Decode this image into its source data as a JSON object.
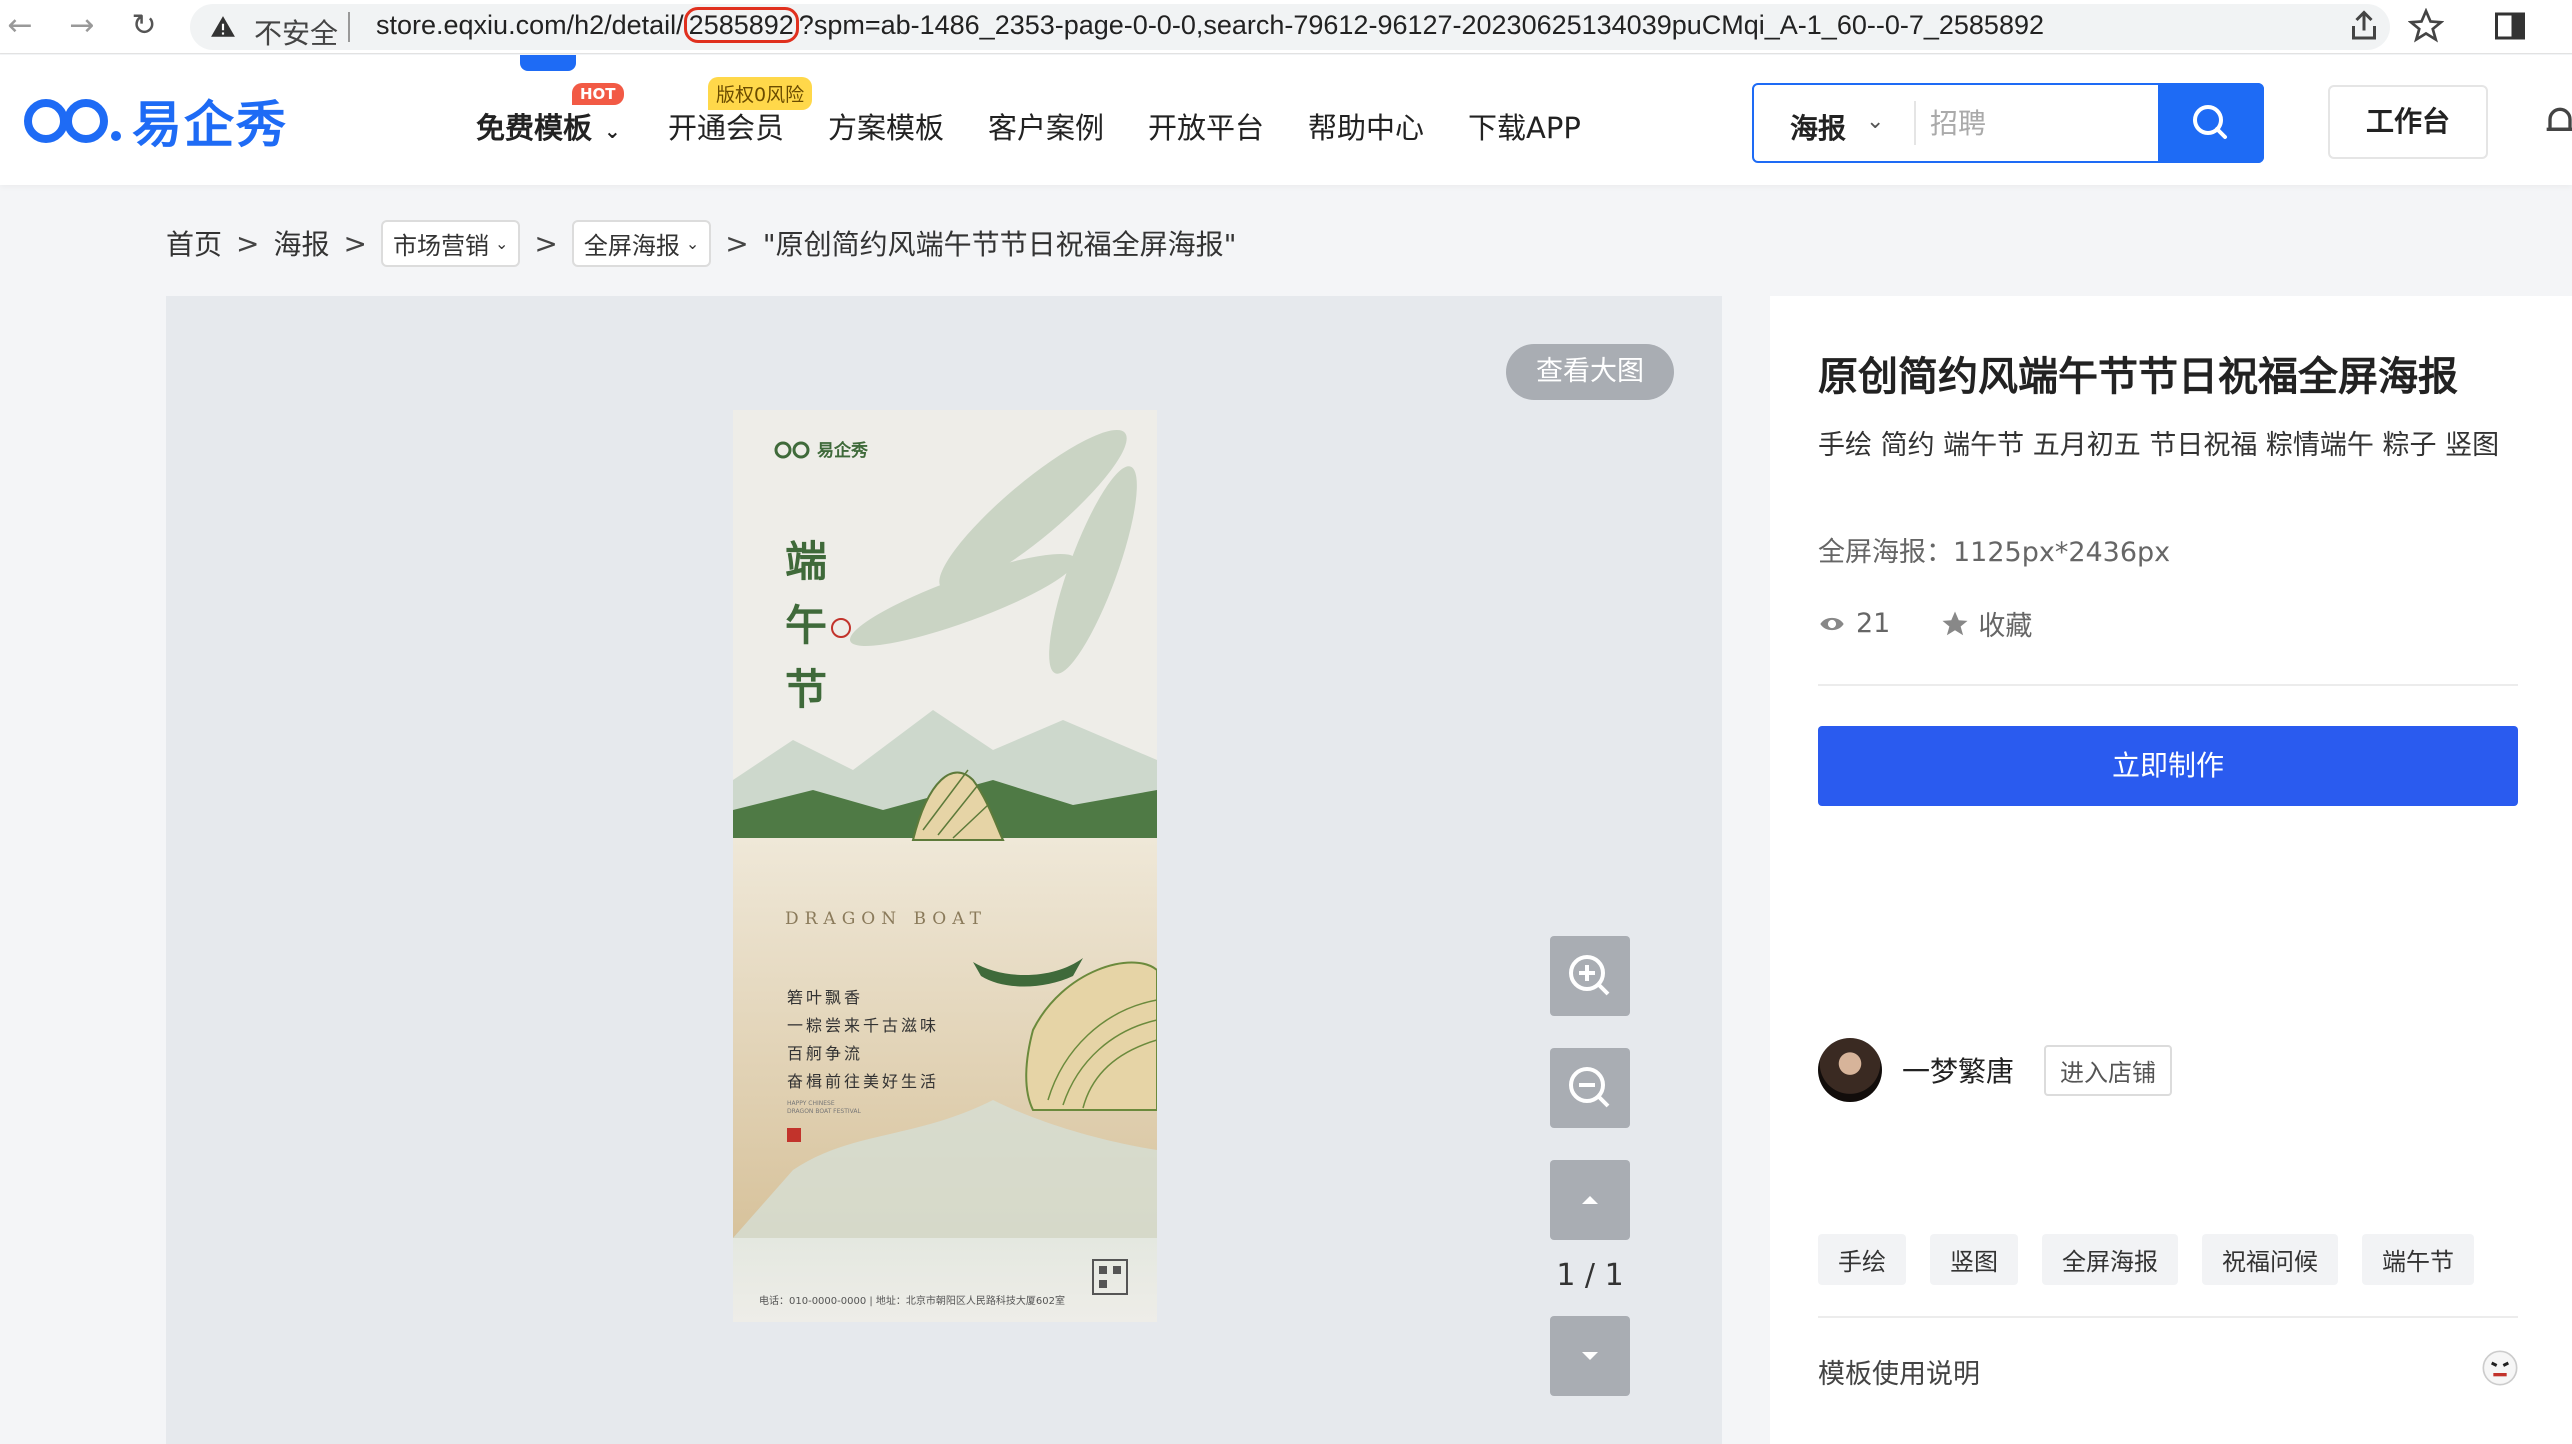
{
  "browser": {
    "insecure_label": "不安全",
    "url_prefix": "store.eqxiu.com/h2/detail/",
    "url_id": "2585892",
    "url_suffix": "?spm=ab-1486_2353-page-0-0-0,search-79612-96127-20230625134039puCMqi_A-1_60--0-7_2585892",
    "icons": [
      "back-arrow-icon",
      "forward-arrow-icon",
      "reload-icon",
      "warning-icon",
      "share-icon",
      "star-icon",
      "side-panel-icon"
    ]
  },
  "header": {
    "logo_text": "易企秀",
    "nav": [
      {
        "label": "免费模板",
        "badge": "HOT"
      },
      {
        "label": "开通会员",
        "badge": "版权0风险"
      },
      {
        "label": "方案模板"
      },
      {
        "label": "客户案例"
      },
      {
        "label": "开放平台"
      },
      {
        "label": "帮助中心"
      },
      {
        "label": "下载APP"
      }
    ],
    "search": {
      "category": "海报",
      "placeholder": "招聘"
    },
    "workbench_label": "工作台"
  },
  "breadcrumb": {
    "home": "首页",
    "poster": "海报",
    "drop1": "市场营销",
    "drop2": "全屏海报",
    "current": "\"原创简约风端午节节日祝福全屏海报\""
  },
  "preview": {
    "view_large_label": "查看大图",
    "page_indicator": "1 / 1",
    "poster": {
      "brand": "易企秀",
      "title_chars": [
        "端",
        "午",
        "节"
      ],
      "english": "DRAGON BOAT",
      "lines": [
        "箬叶飘香",
        "一粽尝来千古滋味",
        "百舸争流",
        "奋楫前往美好生活"
      ],
      "small_en": [
        "HAPPY CHINESE",
        "DRAGON BOAT FESTIVAL"
      ],
      "footer": "电话：010-0000-0000 | 地址：北京市朝阳区人民路科技大厦602室",
      "colors": {
        "green": "#3f6a3a",
        "sand": "#dcc9a3",
        "red": "#c2332b"
      }
    }
  },
  "info": {
    "title": "原创简约风端午节节日祝福全屏海报",
    "description": "手绘 简约 端午节 五月初五 节日祝福 粽情端午 粽子 竖图",
    "size": "全屏海报：1125px*2436px",
    "views": "21",
    "collect_label": "收藏",
    "make_button": "立即制作",
    "author_name": "一梦繁唐",
    "shop_button": "进入店铺",
    "tags": [
      "手绘",
      "竖图",
      "全屏海报",
      "祝福问候",
      "端午节"
    ],
    "usage_label": "模板使用说明"
  },
  "colors": {
    "brand_blue": "#1e6bf5",
    "button_blue": "#2a5bef",
    "hot_red": "#f25a45",
    "vip_yellow": "#ffd84a"
  }
}
